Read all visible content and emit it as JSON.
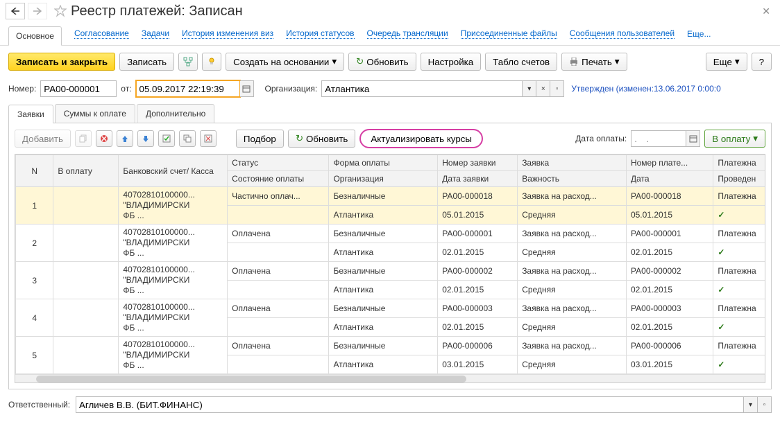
{
  "title": "Реестр платежей: Записан",
  "linkbar": {
    "main": "Основное",
    "agree": "Согласование",
    "tasks": "Задачи",
    "hist_visa": "История изменения виз",
    "hist_status": "История статусов",
    "queue": "Очередь трансляции",
    "files": "Присоединенные файлы",
    "msgs": "Сообщения пользователей",
    "more": "Еще..."
  },
  "toolbar": {
    "save_close": "Записать и закрыть",
    "save": "Записать",
    "create_based": "Создать на основании",
    "refresh": "Обновить",
    "setup": "Настройка",
    "accounts": "Табло счетов",
    "print": "Печать",
    "more": "Еще",
    "help": "?"
  },
  "form": {
    "num_label": "Номер:",
    "num_value": "РА00-000001",
    "from_label": "от:",
    "date_value": "05.09.2017 22:19:39",
    "org_label": "Организация:",
    "org_value": "Атлантика",
    "status_text": "Утвержден (изменен:13.06.2017 0:00:0"
  },
  "tabs": {
    "requests": "Заявки",
    "sums": "Суммы к оплате",
    "extra": "Дополнительно"
  },
  "panel_toolbar": {
    "add": "Добавить",
    "select": "Подбор",
    "refresh": "Обновить",
    "update_rates": "Актуализировать курсы",
    "pay_date_label": "Дата оплаты:",
    "pay_date_value": ".  .",
    "to_pay": "В оплату"
  },
  "headers": {
    "n": "N",
    "to_pay": "В оплату",
    "bank": "Банковский счет/ Касса",
    "status": "Статус",
    "pay_state": "Состояние оплаты",
    "form": "Форма оплаты",
    "org": "Организация",
    "req_num": "Номер заявки",
    "req_date": "Дата заявки",
    "request": "Заявка",
    "importance": "Важность",
    "pay_num": "Номер плате...",
    "pay_date": "Дата",
    "pay_doc": "Платежна",
    "done": "Проведен"
  },
  "rows": [
    {
      "n": "1",
      "bank": "40702810100000... \"ВЛАДИМИРСКИ ФБ ...",
      "status": "Частично оплач...",
      "form": "Безналичные",
      "org": "Атлантика",
      "reqn": "РА00-000018",
      "reqd": "05.01.2015",
      "req": "Заявка на расход...",
      "imp": "Средняя",
      "payn": "РА00-000018",
      "payd": "05.01.2015",
      "plat": "Платежна",
      "done": true,
      "hl": true
    },
    {
      "n": "2",
      "bank": "40702810100000... \"ВЛАДИМИРСКИ ФБ ...",
      "status": "Оплачена",
      "form": "Безналичные",
      "org": "Атлантика",
      "reqn": "РА00-000001",
      "reqd": "02.01.2015",
      "req": "Заявка на расход...",
      "imp": "Средняя",
      "payn": "РА00-000001",
      "payd": "02.01.2015",
      "plat": "Платежна",
      "done": true
    },
    {
      "n": "3",
      "bank": "40702810100000... \"ВЛАДИМИРСКИ ФБ ...",
      "status": "Оплачена",
      "form": "Безналичные",
      "org": "Атлантика",
      "reqn": "РА00-000002",
      "reqd": "02.01.2015",
      "req": "Заявка на расход...",
      "imp": "Средняя",
      "payn": "РА00-000002",
      "payd": "02.01.2015",
      "plat": "Платежна",
      "done": true
    },
    {
      "n": "4",
      "bank": "40702810100000... \"ВЛАДИМИРСКИ ФБ ...",
      "status": "Оплачена",
      "form": "Безналичные",
      "org": "Атлантика",
      "reqn": "РА00-000003",
      "reqd": "02.01.2015",
      "req": "Заявка на расход...",
      "imp": "Средняя",
      "payn": "РА00-000003",
      "payd": "02.01.2015",
      "plat": "Платежна",
      "done": true
    },
    {
      "n": "5",
      "bank": "40702810100000... \"ВЛАДИМИРСКИ ФБ ...",
      "status": "Оплачена",
      "form": "Безналичные",
      "org": "Атлантика",
      "reqn": "РА00-000006",
      "reqd": "03.01.2015",
      "req": "Заявка на расход...",
      "imp": "Средняя",
      "payn": "РА00-000006",
      "payd": "03.01.2015",
      "plat": "Платежна",
      "done": true
    }
  ],
  "footer": {
    "resp_label": "Ответственный:",
    "resp_value": "Агличев В.В. (БИТ.ФИНАНС)"
  }
}
